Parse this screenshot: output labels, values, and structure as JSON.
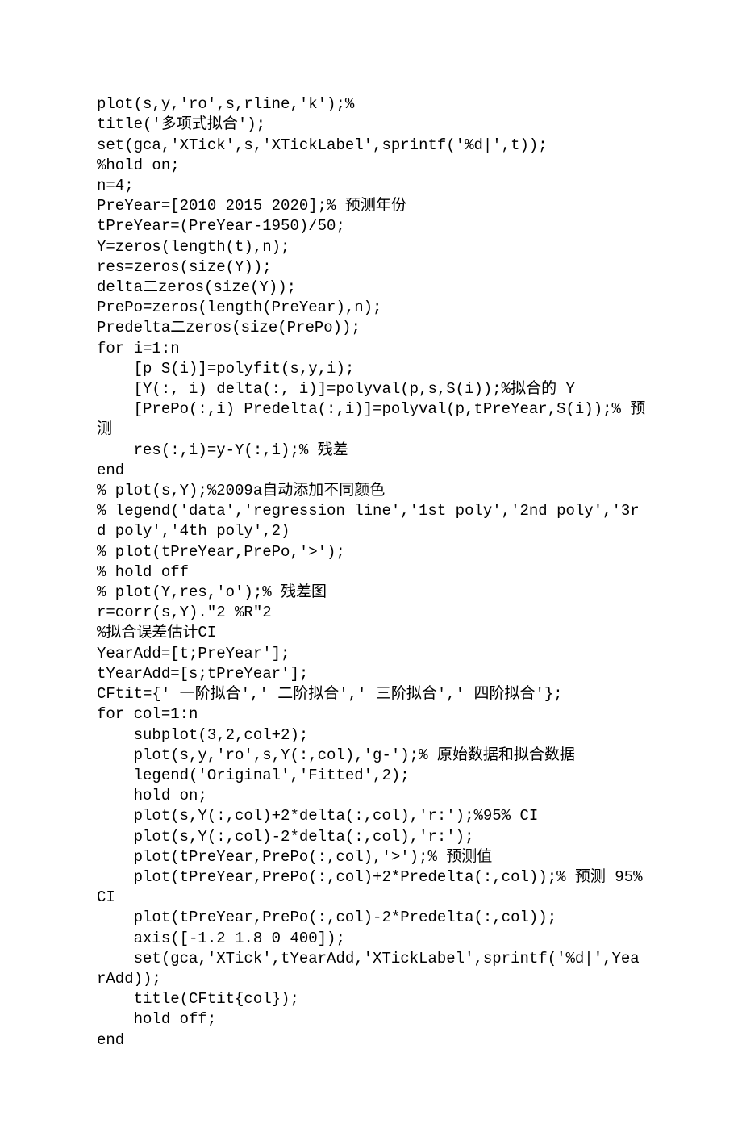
{
  "code": {
    "lines": [
      "plot(s,y,'ro',s,rline,'k');%",
      "title('多项式拟合');",
      "set(gca,'XTick',s,'XTickLabel',sprintf('%d|',t));",
      "%hold on;",
      "n=4;",
      "PreYear=[2010 2015 2020];% 预测年份",
      "tPreYear=(PreYear-1950)/50;",
      "Y=zeros(length(t),n);",
      "res=zeros(size(Y));",
      "delta二zeros(size(Y));",
      "PrePo=zeros(length(PreYear),n);",
      "Predelta二zeros(size(PrePo));",
      "for i=1:n",
      "    [p S(i)]=polyfit(s,y,i);",
      "    [Y(:, i) delta(:, i)]=polyval(p,s,S(i));%拟合的 Y",
      "    [PrePo(:,i) Predelta(:,i)]=polyval(p,tPreYear,S(i));% 预测",
      "    res(:,i)=y-Y(:,i);% 残差",
      "end",
      "% plot(s,Y);%2009a自动添加不同颜色",
      "% legend('data','regression line','1st poly','2nd poly','3rd poly','4th poly',2)",
      "% plot(tPreYear,PrePo,'>');",
      "% hold off",
      "% plot(Y,res,'o');% 残差图",
      "r=corr(s,Y).\"2 %R\"2",
      "%拟合误差估计CI",
      "YearAdd=[t;PreYear'];",
      "tYearAdd=[s;tPreYear'];",
      "CFtit={' 一阶拟合',' 二阶拟合',' 三阶拟合',' 四阶拟合'};",
      "for col=1:n",
      "    subplot(3,2,col+2);",
      "    plot(s,y,'ro',s,Y(:,col),'g-');% 原始数据和拟合数据",
      "    legend('Original','Fitted',2);",
      "    hold on;",
      "    plot(s,Y(:,col)+2*delta(:,col),'r:');%95% CI",
      "    plot(s,Y(:,col)-2*delta(:,col),'r:');",
      "    plot(tPreYear,PrePo(:,col),'>');% 预测值",
      "    plot(tPreYear,PrePo(:,col)+2*Predelta(:,col));% 预测 95% CI",
      "    plot(tPreYear,PrePo(:,col)-2*Predelta(:,col));",
      "    axis([-1.2 1.8 0 400]);",
      "    set(gca,'XTick',tYearAdd,'XTickLabel',sprintf('%d|',YearAdd));",
      "    title(CFtit{col});",
      "    hold off;",
      "end"
    ]
  }
}
